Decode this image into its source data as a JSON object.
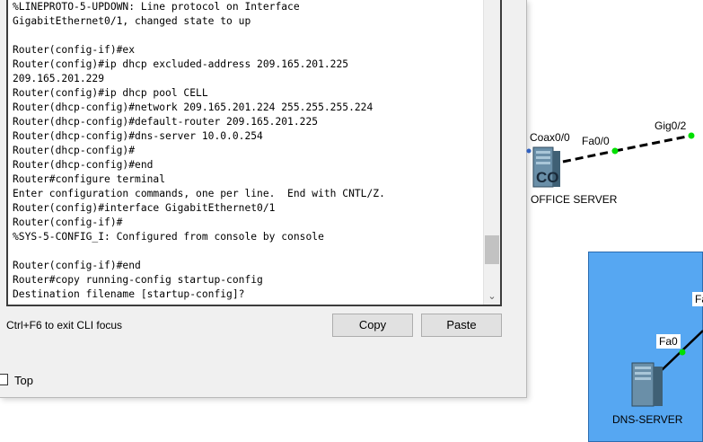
{
  "cli": {
    "lines": [
      "%LINEPROTO-5-UPDOWN: Line protocol on Interface",
      "GigabitEthernet0/1, changed state to up",
      "",
      "Router(config-if)#ex",
      "Router(config)#ip dhcp excluded-address 209.165.201.225",
      "209.165.201.229",
      "Router(config)#ip dhcp pool CELL",
      "Router(dhcp-config)#network 209.165.201.224 255.255.255.224",
      "Router(dhcp-config)#default-router 209.165.201.225",
      "Router(dhcp-config)#dns-server 10.0.0.254",
      "Router(dhcp-config)#",
      "Router(dhcp-config)#end",
      "Router#configure terminal",
      "Enter configuration commands, one per line.  End with CNTL/Z.",
      "Router(config)#interface GigabitEthernet0/1",
      "Router(config-if)#",
      "%SYS-5-CONFIG_I: Configured from console by console",
      "",
      "Router(config-if)#end",
      "Router#copy running-config startup-config",
      "Destination filename [startup-config]?"
    ],
    "hint": "Ctrl+F6 to exit CLI focus",
    "copy_label": "Copy",
    "paste_label": "Paste",
    "top_label": "Top",
    "scroll_down_glyph": "⌄"
  },
  "topology": {
    "coax_label": "Coax0/0",
    "fa00_label": "Fa0/0",
    "gig02_label": "Gig0/2",
    "office_server_label": "OFFICE SERVER",
    "office_server_icon_text": "CO",
    "dns_fa0_label": "Fa0",
    "dns_server_label": "DNS-SERVER",
    "partial_label": "Fa",
    "link_dot_color": "#00e000",
    "blue_area_color": "#56a7f2"
  }
}
